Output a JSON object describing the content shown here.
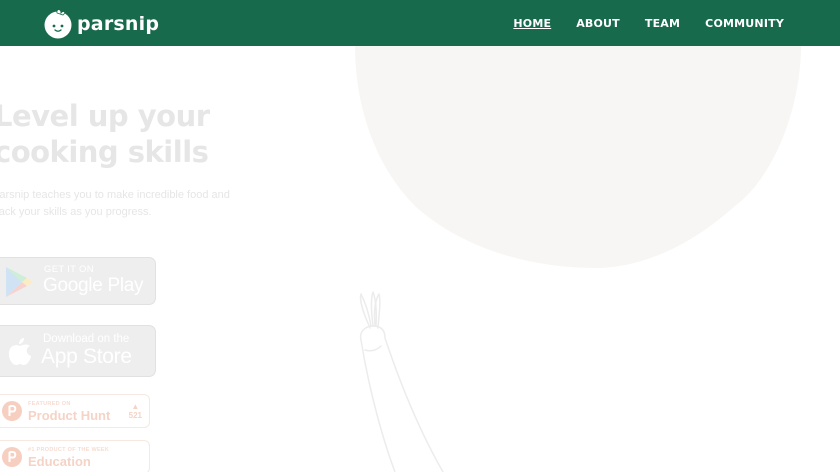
{
  "brand": {
    "name": "parsnip"
  },
  "nav": {
    "links": [
      {
        "label": "HOME",
        "active": true
      },
      {
        "label": "ABOUT"
      },
      {
        "label": "TEAM"
      },
      {
        "label": "COMMUNITY"
      }
    ]
  },
  "hero": {
    "title_line1": "Level up your",
    "title_line2": "cooking skills",
    "subtitle_line1": "Parsnip teaches you to make incredible food and",
    "subtitle_line2": "track your skills as you progress."
  },
  "stores": {
    "google_play": {
      "small": "GET IT ON",
      "big": "Google Play",
      "icon": "google-play-icon"
    },
    "app_store": {
      "small": "Download on the",
      "big": "App Store",
      "icon": "apple-icon"
    }
  },
  "badges": {
    "product_hunt": {
      "top": "FEATURED ON",
      "main": "Product Hunt",
      "votes": "521",
      "icon": "product-hunt-icon"
    },
    "education": {
      "top": "#1 PRODUCT OF THE WEEK",
      "main": "Education",
      "icon": "product-hunt-icon"
    }
  },
  "colors": {
    "nav_bg": "#176a4c",
    "blob": "#f7f6f4",
    "faded_text": "#e6e6e6"
  }
}
